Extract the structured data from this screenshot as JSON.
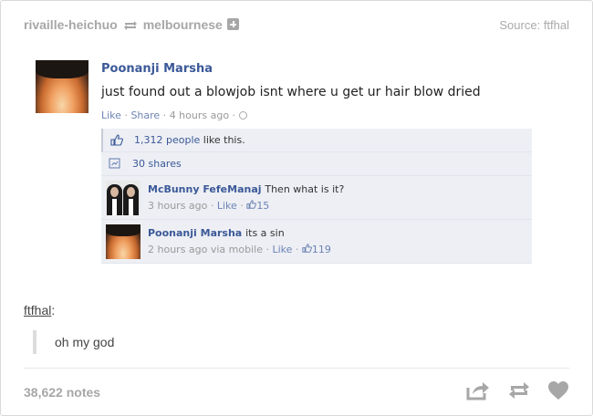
{
  "post": {
    "reblog_header": {
      "from_user": "rivaille-heichuo",
      "to_user": "melbournese",
      "source_label": "Source:",
      "source_user": "ftfhal"
    },
    "fb_post": {
      "poster_name": "Poonanji Marsha",
      "status_text": "just found out a blowjob isnt where u get ur hair blow dried",
      "actions": {
        "like": "Like",
        "share": "Share",
        "time": "4 hours ago"
      },
      "likes": {
        "count": "1,312 people",
        "suffix": "like this."
      },
      "shares": "30 shares",
      "comments": [
        {
          "author": "McBunny FefeManaj",
          "text": "Then what is it?",
          "time": "3 hours ago",
          "like_label": "Like",
          "likes": "15"
        },
        {
          "author": "Poonanji Marsha",
          "text": "its a sin",
          "time": "2 hours ago via mobile",
          "like_label": "Like",
          "likes": "119"
        }
      ]
    },
    "reblog_comment": {
      "user": "ftfhal",
      "text": "oh my god"
    },
    "footer": {
      "notes": "38,622 notes",
      "action_icons": [
        "share-icon",
        "reblog-icon",
        "like-heart-icon"
      ]
    }
  },
  "colors": {
    "fb_blue": "#3b5998",
    "fb_link": "#6d84b4",
    "fb_ufi_bg": "#edeff4",
    "tumblr_gray": "#a7a7a7"
  }
}
